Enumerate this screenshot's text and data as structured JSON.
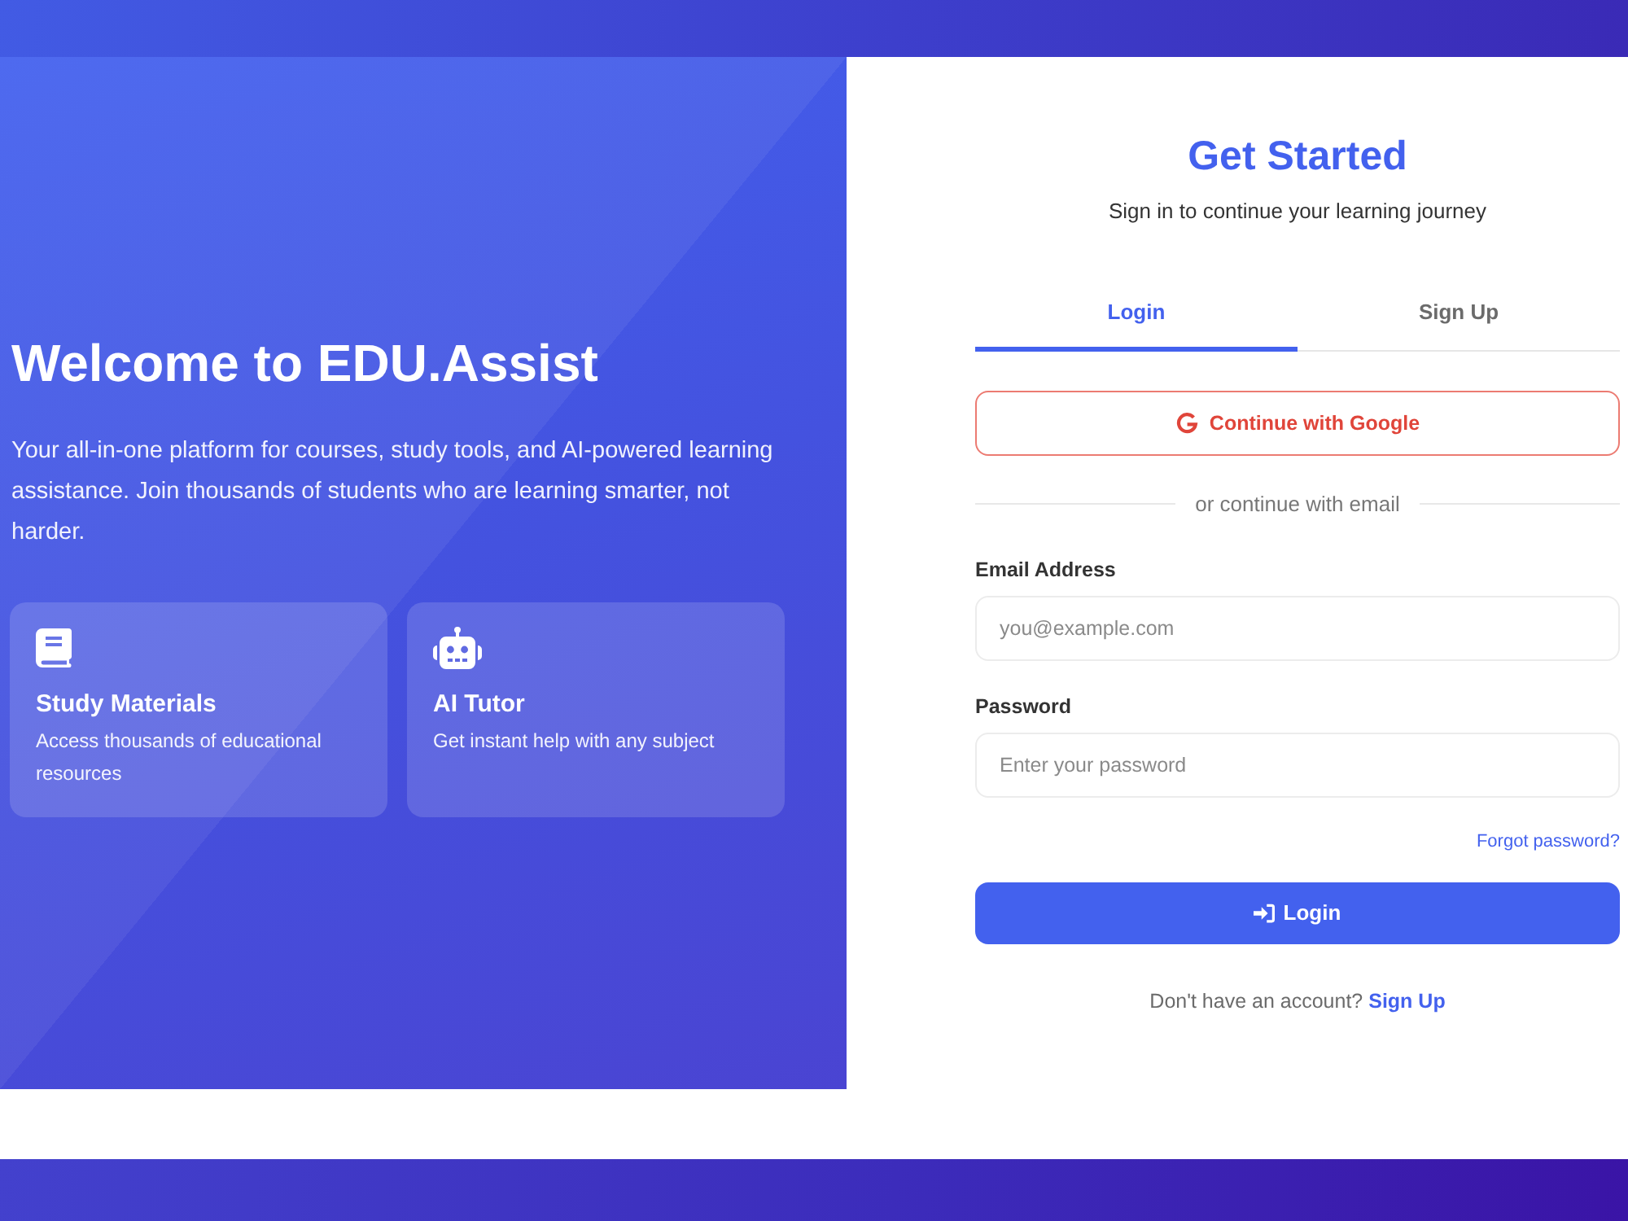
{
  "hero": {
    "title": "Welcome to EDU.Assist",
    "description": "Your all-in-one platform for courses, study tools, and AI-powered learning assistance. Join thousands of students who are learning smarter, not harder.",
    "features": [
      {
        "kind": "book",
        "title": "Study Materials",
        "description": "Access thousands of educational resources"
      },
      {
        "kind": "robot",
        "title": "AI Tutor",
        "description": "Get instant help with any subject"
      }
    ]
  },
  "auth": {
    "title": "Get Started",
    "subtitle": "Sign in to continue your learning journey",
    "tabs": [
      {
        "label": "Login",
        "selected": true
      },
      {
        "label": "Sign Up",
        "selected": false
      }
    ],
    "google_button": "Continue with Google",
    "divider": "or continue with email",
    "fields": [
      {
        "label": "Email Address",
        "placeholder": "you@example.com"
      },
      {
        "label": "Password",
        "placeholder": "Enter your password"
      }
    ],
    "forgot_link": "Forgot password?",
    "submit_button": "Login",
    "footer": {
      "text": "Don't have an account?",
      "link": "Sign Up"
    }
  }
}
